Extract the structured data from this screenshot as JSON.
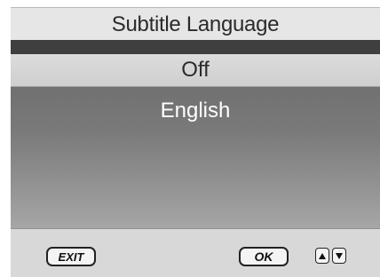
{
  "title": "Subtitle Language",
  "options": [
    {
      "label": "Off",
      "selected": true
    },
    {
      "label": "English",
      "selected": false
    }
  ],
  "footer": {
    "exit_label": "EXIT",
    "ok_label": "OK",
    "up_icon": "triangle-up-icon",
    "down_icon": "triangle-down-icon"
  },
  "colors": {
    "title_bar": "#e6e6e6",
    "selected_item": "#d6d6d6",
    "list_background": "#7a7a7a",
    "footer": "#d8d8d8"
  }
}
